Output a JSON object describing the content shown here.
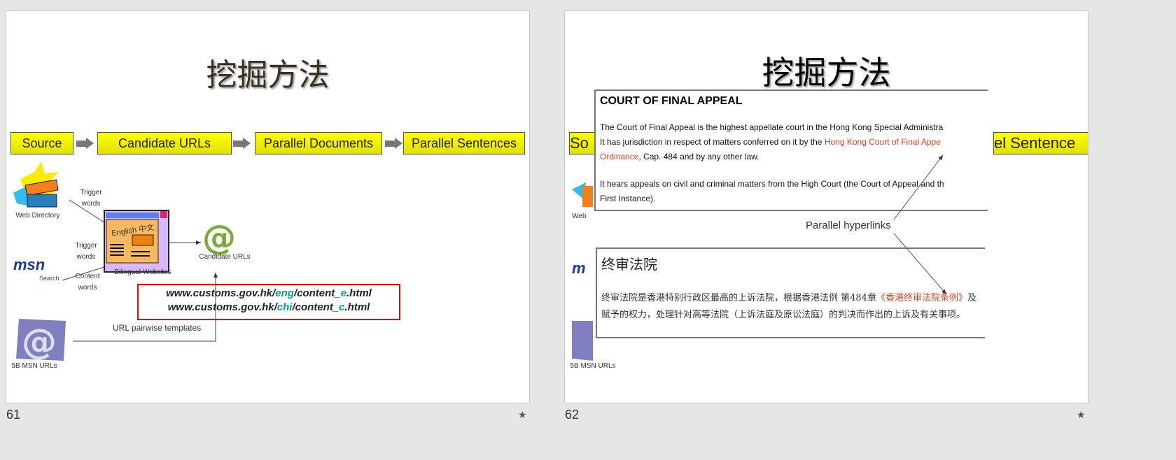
{
  "slides": [
    {
      "number": "61",
      "title": "挖掘方法",
      "flow": [
        "Source",
        "Candidate URLs",
        "Parallel Documents",
        "Parallel Sentences"
      ],
      "labels": {
        "web_directory": "Web Directory",
        "trigger_words_1": "Trigger words",
        "trigger_words_2": "Trigger words",
        "content_words": "Content words",
        "msn": "msn",
        "msn_search": "Search",
        "bilingual_websites": "Bilingual Websites",
        "window_text": "English 中文",
        "candidate_urls": "Candidate URLs",
        "msn_urls": "5B MSN URLs",
        "url_templates": "URL pairwise templates"
      },
      "url_template": {
        "line1": {
          "prefix": "www.customs.gov.hk/",
          "lang": "eng",
          "mid": "/content_",
          "suffix_char": "e",
          "ext": ".html"
        },
        "line2": {
          "prefix": "www.customs.gov.hk/",
          "lang": "chi",
          "mid": "/content_",
          "suffix_char": "c",
          "ext": ".html"
        }
      }
    },
    {
      "number": "62",
      "title": "挖掘方法",
      "flow_partial": [
        "So",
        "el Sentence"
      ],
      "labels": {
        "web": "Web",
        "msn": "m",
        "msn_urls": "5B MSN URLs",
        "parallel_hyperlinks": "Parallel hyperlinks"
      },
      "english_panel": {
        "heading": "COURT OF FINAL APPEAL",
        "p1_line1": "The Court of Final Appeal is the highest appellate court in the Hong Kong Special Administra",
        "p1_line2_pre": "It has jurisdiction in respect of matters conferred on it by the ",
        "p1_link1": "Hong Kong Court of Final Appe",
        "p1_link2": "Ordinance",
        "p1_line3_post": ", Cap. 484 and by any other law.",
        "p2_line1": "It hears appeals on civil and criminal matters from the High Court (the Court of Appeal and th",
        "p2_line2": "First Instance)."
      },
      "chinese_panel": {
        "heading": "终审法院",
        "line1_pre": "终审法院是香港特别行政区最高的上诉法院，根据香港法例 第484章",
        "line1_link": "《香港终审法院条例》",
        "line1_post": "及",
        "line2": "赋予的权力，处理针对高等法院（上诉法庭及原讼法庭）的判决而作出的上诉及有关事项。"
      }
    }
  ],
  "colors": {
    "flow_box": "#ffff00",
    "url_box_border": "#ee0000",
    "lang_highlight": "#0a9a9a",
    "link": "#e8401a",
    "background": "#e6e6e6"
  },
  "icons": [
    "web-directory-books-icon",
    "msn-butterfly-icon",
    "bilingual-window-icon",
    "green-at-icon",
    "blue-at-icon",
    "slide-transition-star-icon"
  ]
}
